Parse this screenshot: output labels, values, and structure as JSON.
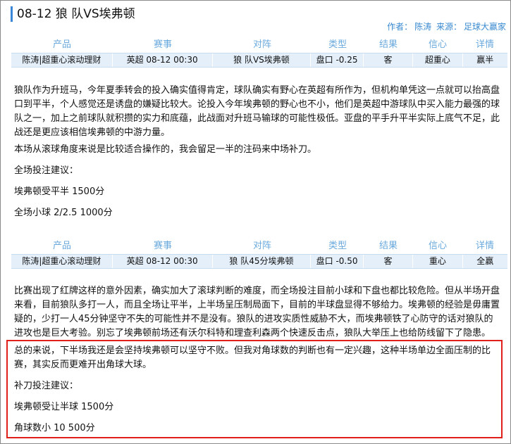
{
  "header": {
    "title": "08-12   狼 队VS埃弗顿",
    "author_label": "作者：",
    "author": "陈涛",
    "source_label": "来源：",
    "source": "足球大赢家"
  },
  "table_headers": [
    "产品",
    "赛事",
    "对阵",
    "类型",
    "结果",
    "信心",
    "详情"
  ],
  "tables": [
    {
      "row": [
        "陈涛|超重心滚动理财",
        "英超 08-12 00:30",
        "狼 队VS埃弗顿",
        "盘口 -0.25",
        "客",
        "超重心",
        "赢半"
      ]
    },
    {
      "row": [
        "陈涛|超重心滚动理财",
        "英超 08-12 00:30",
        "狼 队45分埃弗顿",
        "盘口 -0.50",
        "客",
        "重心",
        "全赢"
      ]
    }
  ],
  "article1": {
    "p1": "狼队作为升班马，今年夏季转会的投入确实值得肯定，球队确实有野心在英超有所作为，但机构单凭这一点就可以抬高盘口到平半，个人感觉还是诱盘的嫌疑比较大。论投入今年埃弗顿的野心也不小，他们是英超中游球队中买入能力最强的球队之一，加上之前球队就积攒的实力和底蕴，此战面对升班马输球的可能性极低。亚盘的平手升平半实际上底气不足，此战还是更应该相信埃弗顿的中游力量。",
    "p2": "本场从滚球角度来说是比较适合操作的，我会留足一半的注码来中场补刀。",
    "p3": "全场投注建议：",
    "p4": "埃弗顿受平半   1500分",
    "p5": "全场小球   2/2.5    1000分"
  },
  "article2": {
    "p1": "比赛出现了红牌这样的意外因素，确实加大了滚球判断的难度，而全场投注目前小球和下盘也都比较危险。但从半场开盘来看，目前狼队多打一人，而且全场让平半，上半场呈压制局面下，目前的半球盘显得不够给力。埃弗顿的经验是毋庸置疑的，少打一人45分钟坚守不失的可能性并不是没有。狼队的进攻实质性威胁不大，而埃弗顿铁了心防守的话对狼队的进攻也是巨大考验。别忘了埃弗顿前场还有沃尔科特和理查利森两个快速反击点，狼队大举压上也给防线留下了隐患。",
    "p2": "总的来说，下半场我还是会坚持埃弗顿可以坚守不败。但我对角球数的判断也有一定兴趣，这种半场单边全面压制的比赛，其实反而更难开出角球大球。",
    "p3": "补刀投注建议：",
    "p4": "埃弗顿受让半球    1500分",
    "p5": "角球数小   10    500分"
  }
}
